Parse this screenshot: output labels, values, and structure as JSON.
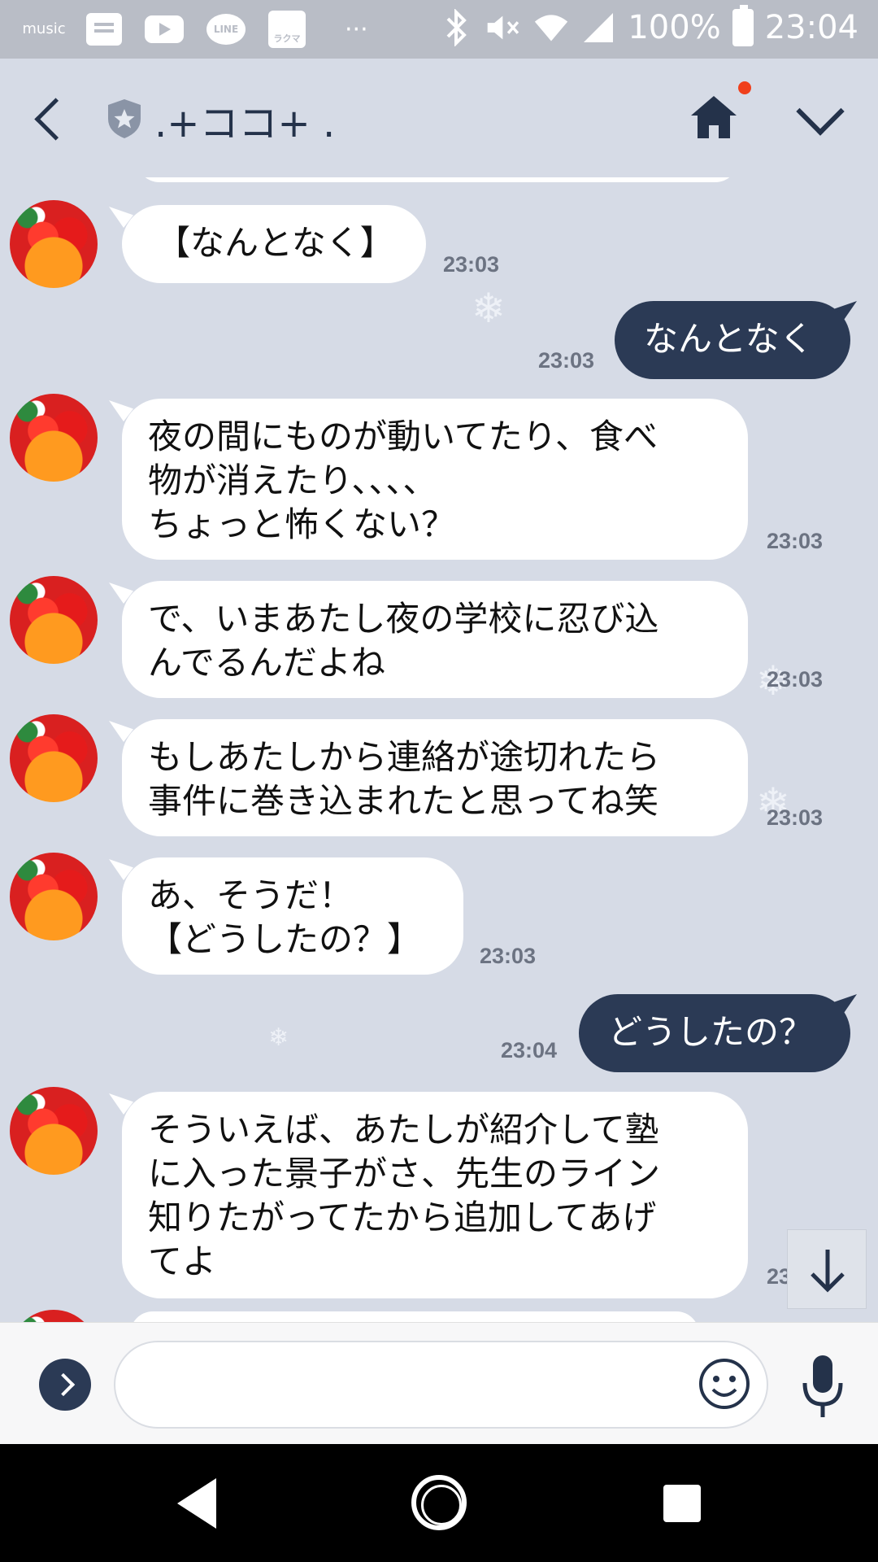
{
  "status_bar": {
    "music_label": "music",
    "line_label": "LINE",
    "rawma_label": "ラクマ",
    "overflow": "···",
    "battery": "100%",
    "time": "23:04"
  },
  "header": {
    "title": ".+ココ+ ."
  },
  "messages": [
    {
      "side": "in",
      "text": "【なんとなく】",
      "time": "23:03"
    },
    {
      "side": "out",
      "text": "なんとなく",
      "time": "23:03"
    },
    {
      "side": "in",
      "text": "夜の間にものが動いてたり、食べ\n物が消えたり、、、、\nちょっと怖くない？",
      "time": "23:03"
    },
    {
      "side": "in",
      "text": "で、いまあたし夜の学校に忍び込\nんでるんだよね",
      "time": "23:03"
    },
    {
      "side": "in",
      "text": "もしあたしから連絡が途切れたら\n事件に巻き込まれたと思ってね笑",
      "time": "23:03"
    },
    {
      "side": "in",
      "text": "あ、そうだ！\n【どうしたの？】",
      "time": "23:03"
    },
    {
      "side": "out",
      "text": "どうしたの？",
      "time": "23:04"
    },
    {
      "side": "in",
      "text": "そういえば、あたしが紹介して塾\nに入った景子がさ、先生のライン\n知りたがってたから追加してあげ\nてよ",
      "time": "23:0"
    }
  ],
  "input": {
    "value": "",
    "placeholder": ""
  },
  "colors": {
    "background": "#d6dbe6",
    "outgoing_bubble": "#2b3a55",
    "incoming_bubble": "#ffffff",
    "status_bar": "#b9bdc6",
    "notification_dot": "#f0401c"
  },
  "icons": {
    "back": "chevron-left-icon",
    "shield": "shield-star-icon",
    "home": "home-icon",
    "menu": "chevron-down-icon",
    "scroll_down": "arrow-down-icon",
    "expand": "chevron-right-icon",
    "emoji": "smiley-icon",
    "mic": "microphone-icon"
  }
}
